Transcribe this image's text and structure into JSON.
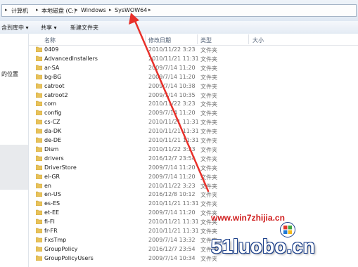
{
  "breadcrumb": {
    "items": [
      "计算机",
      "本地磁盘 (C:)",
      "Windows",
      "SysWOW64"
    ]
  },
  "toolbar": {
    "include_label": "含到库中 ▾",
    "share_label": "共享 ▾",
    "new_folder_label": "新建文件夹"
  },
  "nav": {
    "location_text": "的位置"
  },
  "columns": {
    "name": "名称",
    "date": "修改日期",
    "type": "类型",
    "size": "大小"
  },
  "rows": [
    {
      "name": "0409",
      "date": "2010/11/22 3:23",
      "type": "文件夹"
    },
    {
      "name": "AdvancedInstallers",
      "date": "2010/11/21 11:31",
      "type": "文件夹"
    },
    {
      "name": "ar-SA",
      "date": "2009/7/14 11:20",
      "type": "文件夹"
    },
    {
      "name": "bg-BG",
      "date": "2009/7/14 11:20",
      "type": "文件夹"
    },
    {
      "name": "catroot",
      "date": "2009/7/14 10:38",
      "type": "文件夹"
    },
    {
      "name": "catroot2",
      "date": "2009/7/14 10:35",
      "type": "文件夹"
    },
    {
      "name": "com",
      "date": "2010/11/22 3:23",
      "type": "文件夹"
    },
    {
      "name": "config",
      "date": "2009/7/14 11:20",
      "type": "文件夹"
    },
    {
      "name": "cs-CZ",
      "date": "2010/11/21 11:31",
      "type": "文件夹"
    },
    {
      "name": "da-DK",
      "date": "2010/11/21 11:31",
      "type": "文件夹"
    },
    {
      "name": "de-DE",
      "date": "2010/11/21 11:31",
      "type": "文件夹"
    },
    {
      "name": "Dism",
      "date": "2010/11/22 3:23",
      "type": "文件夹"
    },
    {
      "name": "drivers",
      "date": "2016/12/7 23:54",
      "type": "文件夹"
    },
    {
      "name": "DriverStore",
      "date": "2009/7/14 11:20",
      "type": "文件夹"
    },
    {
      "name": "el-GR",
      "date": "2009/7/14 11:20",
      "type": "文件夹"
    },
    {
      "name": "en",
      "date": "2010/11/22 3:23",
      "type": "文件夹"
    },
    {
      "name": "en-US",
      "date": "2016/12/8 10:12",
      "type": "文件夹"
    },
    {
      "name": "es-ES",
      "date": "2010/11/21 11:31",
      "type": "文件夹"
    },
    {
      "name": "et-EE",
      "date": "2009/7/14 11:20",
      "type": "文件夹"
    },
    {
      "name": "fi-FI",
      "date": "2010/11/21 11:31",
      "type": "文件夹"
    },
    {
      "name": "fr-FR",
      "date": "2010/11/21 11:31",
      "type": "文件夹"
    },
    {
      "name": "FxsTmp",
      "date": "2009/7/14 13:32",
      "type": "文件夹"
    },
    {
      "name": "GroupPolicy",
      "date": "2016/12/7 23:54",
      "type": "文件夹"
    },
    {
      "name": "GroupPolicyUsers",
      "date": "2009/7/14 10:34",
      "type": "文件夹"
    }
  ],
  "watermark": {
    "url": "www.win7zhijia.cn",
    "brand": "51luobo.cn"
  },
  "colors": {
    "arrow": "#e8302a",
    "folder": "#e8c25a",
    "watermark_red": "#cf1c1c"
  }
}
